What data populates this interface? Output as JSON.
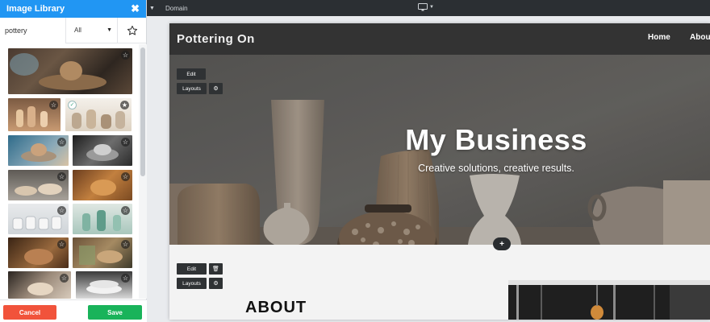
{
  "sidebar": {
    "title": "Image Library",
    "close_icon": "close-x-icon",
    "search": {
      "value": "pottery",
      "placeholder": ""
    },
    "filter": {
      "selected": "All",
      "options": [
        "All"
      ]
    },
    "favorites_filter_icon": "star-outline-icon",
    "thumb_count": 14,
    "cancel_label": "Cancel",
    "save_label": "Save"
  },
  "topbar": {
    "domain_label": "Domain",
    "device_icon": "desktop-monitor-icon"
  },
  "site": {
    "brand": "Pottering On",
    "nav": [
      "Home",
      "Abou"
    ],
    "hero_title": "My Business",
    "hero_subtitle": "Creative solutions, creative results.",
    "about_heading": "ABOUT"
  },
  "editor_controls": {
    "hero_edit": "Edit",
    "hero_layouts": "Layouts",
    "about_edit": "Edit",
    "about_layouts": "Layouts",
    "add_section": "+"
  },
  "colors": {
    "sidebar_header": "#2196f3",
    "cancel": "#f1533b",
    "save": "#19b35a",
    "topbar": "#2b2f33",
    "site_nav": "#333333"
  }
}
